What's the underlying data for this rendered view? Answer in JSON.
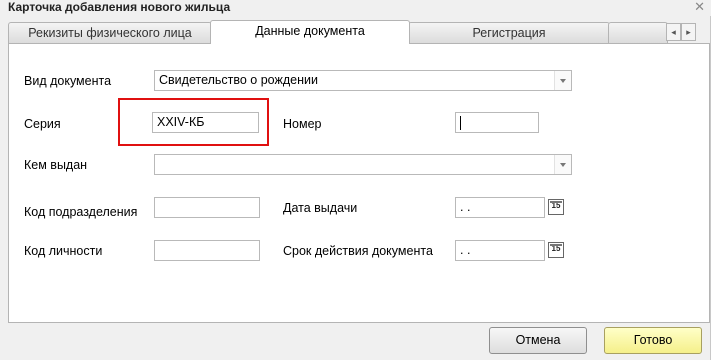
{
  "window": {
    "title": "Карточка добавления нового жильца",
    "close_glyph": "✕"
  },
  "tabs": [
    {
      "label": "Рекизиты физического лица",
      "active": false
    },
    {
      "label": "Данные документа",
      "active": true
    },
    {
      "label": "Регистрация",
      "active": false
    }
  ],
  "tab_scroll": {
    "left": "◂",
    "right": "▸"
  },
  "form": {
    "doc_type": {
      "label": "Вид документа",
      "value": "Свидетельство о рождении"
    },
    "series": {
      "label": "Серия",
      "value": "XXIV-КБ"
    },
    "number": {
      "label": "Номер",
      "value": ""
    },
    "issued_by": {
      "label": "Кем выдан",
      "value": ""
    },
    "division_code": {
      "label": "Код подразделения",
      "value": ""
    },
    "issue_date": {
      "label": "Дата выдачи",
      "value": " .  ."
    },
    "personal_code": {
      "label": "Код личности",
      "value": ""
    },
    "validity": {
      "label": "Срок действия документа",
      "value": " .  ."
    },
    "calendar_glyph": "15"
  },
  "buttons": {
    "cancel": "Отмена",
    "ok": "Готово"
  },
  "colors": {
    "highlight": "#e01010",
    "ok_button": "#f5f08a"
  }
}
